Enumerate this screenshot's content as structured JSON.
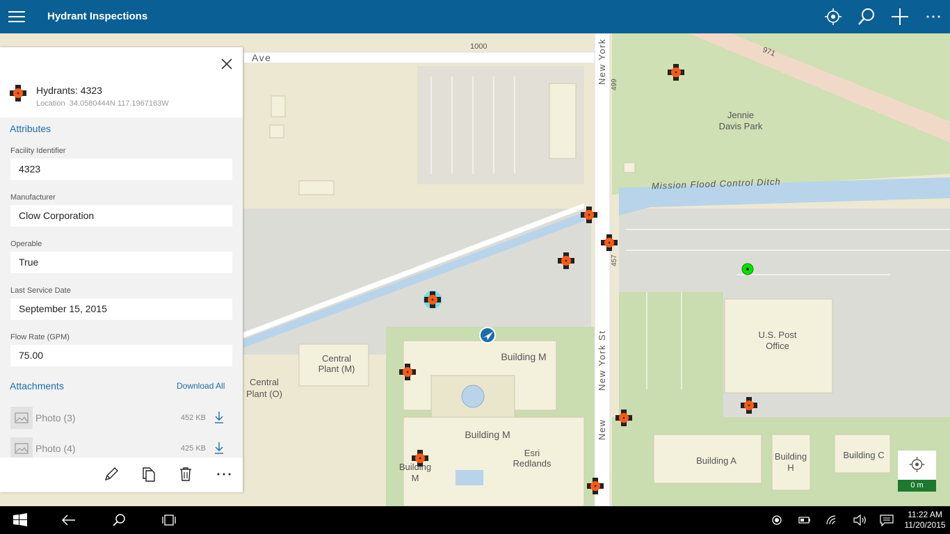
{
  "app": {
    "title": "Hydrant Inspections"
  },
  "feature": {
    "title": "Hydrants: 4323",
    "location_label": "Location",
    "location_value": "34.0580444N 117.1967163W"
  },
  "attributes": {
    "heading": "Attributes",
    "fields": [
      {
        "label": "Facility Identifier",
        "value": "4323"
      },
      {
        "label": "Manufacturer",
        "value": "Clow Corporation"
      },
      {
        "label": "Operable",
        "value": "True"
      },
      {
        "label": "Last Service Date",
        "value": "September 15, 2015"
      },
      {
        "label": "Flow Rate (GPM)",
        "value": "75.00"
      }
    ]
  },
  "attachments": {
    "heading": "Attachments",
    "download_all": "Download All",
    "items": [
      {
        "name": "Photo (3)",
        "size": "452 KB"
      },
      {
        "name": "Photo (4)",
        "size": "425 KB"
      }
    ]
  },
  "map": {
    "scale": "0 m",
    "labels": {
      "ave": "Ave",
      "street_1000": "1000",
      "new_york_top": "New York",
      "num_499": "499",
      "num_971": "971",
      "num_457": "457",
      "jennie_1": "Jennie",
      "jennie_2": "Davis Park",
      "ditch": "Mission Flood Control Ditch",
      "post_1": "U.S. Post",
      "post_2": "Office",
      "central_m_1": "Central",
      "central_m_2": "Plant (M)",
      "central_o_1": "Central",
      "central_o_2": "Plant (O)",
      "building_m": "Building M",
      "building_m2": "Building M",
      "building_m3_1": "Building",
      "building_m3_2": "M",
      "esri_1": "Esri",
      "esri_2": "Redlands",
      "new_york_st": "New York St",
      "new_york_st_lower": "New",
      "building_a": "Building A",
      "building_h_1": "Building",
      "building_h_2": "H",
      "building_c": "Building C"
    }
  },
  "taskbar": {
    "time": "11:22 AM",
    "date": "11/20/2015"
  },
  "colors": {
    "accent": "#0a5f95",
    "hydrant": "#ff5a14",
    "link": "#1a6ea8",
    "gps": "#00e000"
  }
}
